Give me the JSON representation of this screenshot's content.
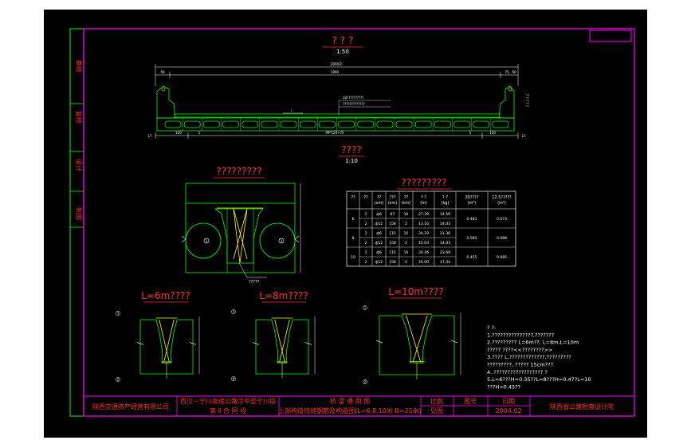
{
  "titles": {
    "main_section": "? ? ?",
    "main_scale": "1:50",
    "detail_2": "????",
    "detail_2_scale": "1:10",
    "joint_detail": "?????????",
    "rebar_table": "?????????",
    "span_6": "L=6m????",
    "span_8": "L=8m????",
    "span_10": "L=10m????"
  },
  "labels": {
    "total_width": "2000/2",
    "top_left": "50",
    "top_mid": "1900",
    "top_r1": "75",
    "top_r2": "50",
    "deck_note_1": "10??????????",
    "deck_note_2": "?????????????",
    "slope": "i",
    "bot_17a": "17",
    "bot_120a": "120",
    "bot_mid": "99*120+75",
    "bot_1": "1",
    "bot_120b": "120",
    "bot_17b": "17",
    "right_vertical": "? ? ? ? ?",
    "joint_callout": "?????",
    "hole_a": "2",
    "hole_b": "3",
    "c1": "1",
    "c2": "2",
    "c3": "3",
    "c4": "4",
    "c6a": "70",
    "c6b": "100",
    "c6c": "100"
  },
  "table": {
    "headers": [
      "??",
      "??",
      "??\n(cm)",
      "???\n(cm)",
      "??\n(cm)",
      "? ?\n(m)",
      "? ?\n(kg)",
      "30????\n(m³)",
      "12.5?????\n(m³)"
    ],
    "rows": [
      [
        "6",
        "1",
        "ф6",
        "87",
        "10",
        "27.39",
        "14.59",
        "0.481",
        "0.073"
      ],
      [
        "",
        "2",
        "ф12",
        "158",
        "2",
        "13.16",
        "14.03",
        "",
        ""
      ],
      [
        "8",
        "1",
        "ф6",
        "115",
        "15",
        "34.19",
        "21.36",
        "0.585",
        "0.088"
      ],
      [
        "",
        "2",
        "ф12",
        "158",
        "2",
        "15.03",
        "14.03",
        "",
        ""
      ],
      [
        "10",
        "1",
        "ф6",
        "115",
        "16",
        "34.26",
        "23.68",
        "0.455",
        "0.085"
      ],
      [
        "",
        "2",
        "ф12",
        "158",
        "2",
        "16.00",
        "17.34",
        "",
        ""
      ]
    ]
  },
  "notes": [
    "? ?:",
    "1.???????????????,???????",
    "2.?????????    L=6m??,    L=8m,L=10m",
    "  ????? ????<<????????>>",
    "3.???? L,?????????????,?????????",
    "  ?????????,    ?????  15cm???.",
    "4. ??????????????????    ?",
    "5.L=6???H=0.35??L=8???H=0.47?L=10",
    "  ???H=0.45??"
  ],
  "sidebar": [
    "审核",
    "复核",
    "设计",
    "制图"
  ],
  "titleblock": {
    "company": "陕西交通资产经营有限公司",
    "project_1": "西汉－宁川高速公路汉中至宁川段",
    "project_2": "第 Ⅱ 合 同 段",
    "drawing_1": "桥 梁 通 用 图",
    "drawing_2": "上部构造铰缝钢筋及构造图(L=6,8,10米 B=25米)",
    "h_scale": "比例",
    "h_no": "图号",
    "h_date": "日期",
    "scale": "见图",
    "date": "2004.02",
    "designer": "陕西省公路勘察设计院"
  },
  "colors": {
    "background": "#000000",
    "page": "#ffffff",
    "frame": "#ff00ff",
    "geometry": "#00ff00",
    "rebar": "#ffff00",
    "dimension": "#ffffff",
    "title": "#ff3030"
  }
}
